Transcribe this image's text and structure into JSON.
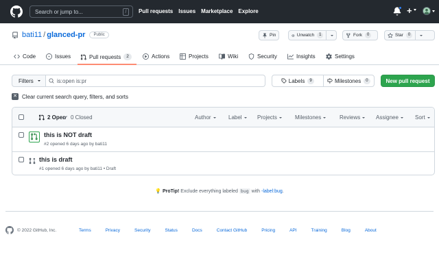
{
  "header": {
    "search_placeholder": "Search or jump to...",
    "search_key": "/",
    "nav": [
      "Pull requests",
      "Issues",
      "Marketplace",
      "Explore"
    ]
  },
  "repo": {
    "owner": "bati11",
    "separator": "/",
    "name": "glanced-pr",
    "visibility": "Public",
    "pin_label": "Pin",
    "unwatch_label": "Unwatch",
    "unwatch_count": "1",
    "fork_label": "Fork",
    "fork_count": "0",
    "star_label": "Star",
    "star_count": "0"
  },
  "tabs": {
    "code": "Code",
    "issues": "Issues",
    "pulls": "Pull requests",
    "pulls_count": "2",
    "actions": "Actions",
    "projects": "Projects",
    "wiki": "Wiki",
    "security": "Security",
    "insights": "Insights",
    "settings": "Settings"
  },
  "filters": {
    "filters_label": "Filters",
    "query": "is:open is:pr",
    "labels_label": "Labels",
    "labels_count": "9",
    "milestones_label": "Milestones",
    "milestones_count": "0",
    "new_pr_label": "New pull request",
    "clear_label": "Clear current search query, filters, and sorts"
  },
  "list": {
    "open_label": "2 Open",
    "closed_label": "0 Closed",
    "sort_menus": [
      "Author",
      "Label",
      "Projects",
      "Milestones",
      "Reviews",
      "Assignee",
      "Sort"
    ],
    "items": [
      {
        "title": "this is NOT draft",
        "meta": "#2 opened 6 days ago by bati11"
      },
      {
        "title": "this is draft",
        "meta": "#1 opened 6 days ago by bati11 • Draft"
      }
    ]
  },
  "protip": {
    "lead": "ProTip!",
    "text1": " Exclude everything labeled ",
    "code": "bug",
    "text2": " with ",
    "link": "-label:bug",
    "end": "."
  },
  "footer": {
    "copyright": "© 2022 GitHub, Inc.",
    "links": [
      "Terms",
      "Privacy",
      "Security",
      "Status",
      "Docs",
      "Contact GitHub",
      "Pricing",
      "API",
      "Training",
      "Blog",
      "About"
    ]
  },
  "colors": {
    "header_bg": "#24292f",
    "link": "#0969da",
    "primary_button": "#2da44e",
    "tab_underline": "#fd8c73",
    "notification_dot": "#2f81f7"
  },
  "icons": [
    "github-logo-icon",
    "bell-icon",
    "plus-icon",
    "repo-icon",
    "pin-icon",
    "eye-icon",
    "fork-icon",
    "star-icon",
    "code-icon",
    "issue-icon",
    "pull-request-icon",
    "play-icon",
    "table-icon",
    "book-icon",
    "shield-icon",
    "graph-icon",
    "gear-icon",
    "search-icon",
    "tag-icon",
    "milestone-icon",
    "check-icon",
    "draft-pr-icon",
    "lightbulb-icon"
  ]
}
